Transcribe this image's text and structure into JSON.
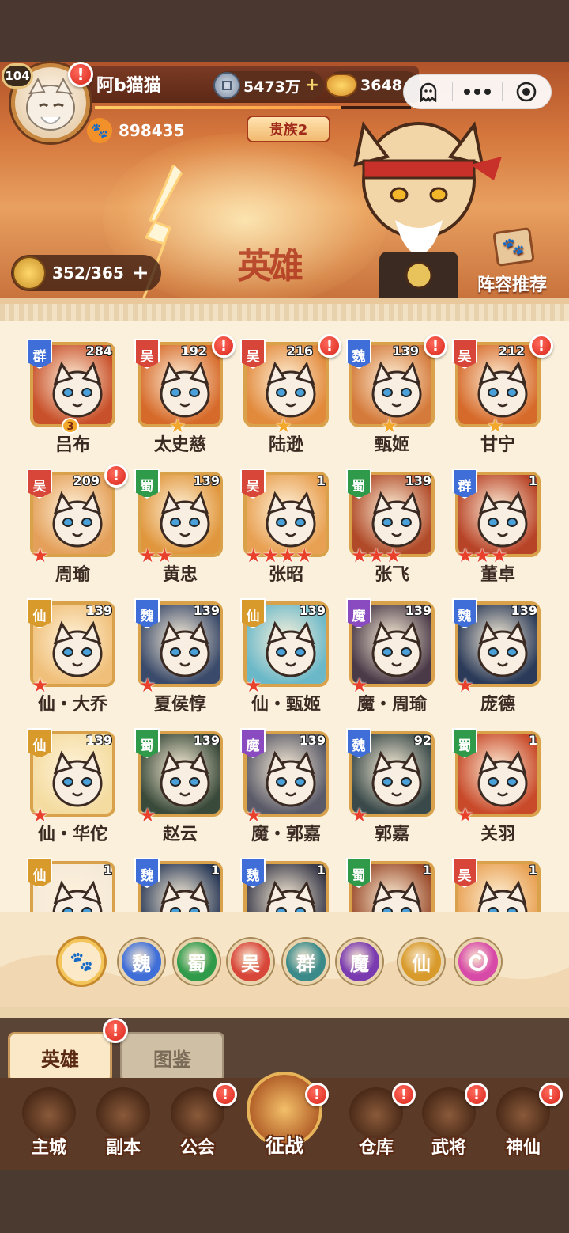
{
  "player": {
    "level": "104",
    "name": "阿b猫猫",
    "silver": "5473万",
    "gold": "3648",
    "power": "898435",
    "noble": "贵族2",
    "roster": "352/365",
    "lineup_label": "阵容推荐",
    "xp_fraction": 0.78
  },
  "banner": {
    "art_text": "英雄"
  },
  "colors": {
    "群": "#3f6ed8",
    "吴": "#d8463a",
    "魏": "#3f6ed8",
    "蜀": "#2f9a4a",
    "仙": "#d89a2a",
    "魔": "#8a4ac0"
  },
  "heroes": [
    {
      "faction": "群",
      "level": "284",
      "name": "吕布",
      "stars": 1,
      "star_color": "gold",
      "awaken": "3",
      "alert": false,
      "bg": "#c8502a"
    },
    {
      "faction": "吴",
      "level": "192",
      "name": "太史慈",
      "stars": 1,
      "star_color": "gold",
      "alert": true,
      "bg": "#d66a2a"
    },
    {
      "faction": "吴",
      "level": "216",
      "name": "陆逊",
      "stars": 1,
      "star_color": "gold",
      "alert": true,
      "bg": "#e28a3c"
    },
    {
      "faction": "魏",
      "level": "139",
      "name": "甄姬",
      "stars": 1,
      "star_color": "gold",
      "alert": true,
      "bg": "#d47a3a"
    },
    {
      "faction": "吴",
      "level": "212",
      "name": "甘宁",
      "stars": 1,
      "star_color": "gold",
      "alert": true,
      "bg": "#d66a2a"
    },
    {
      "faction": "吴",
      "level": "209",
      "name": "周瑜",
      "stars": 1,
      "star_color": "red",
      "alert": true,
      "bg": "#e4a05a"
    },
    {
      "faction": "蜀",
      "level": "139",
      "name": "黄忠",
      "stars": 2,
      "star_color": "red",
      "alert": false,
      "bg": "#e0963c"
    },
    {
      "faction": "吴",
      "level": "1",
      "name": "张昭",
      "stars": 4,
      "star_color": "red",
      "alert": false,
      "bg": "#e8a052"
    },
    {
      "faction": "蜀",
      "level": "139",
      "name": "张飞",
      "stars": 3,
      "star_color": "red",
      "alert": false,
      "bg": "#b04a28"
    },
    {
      "faction": "群",
      "level": "1",
      "name": "董卓",
      "stars": 3,
      "star_color": "red",
      "alert": false,
      "bg": "#b84428"
    },
    {
      "faction": "仙",
      "level": "139",
      "name": "仙・大乔",
      "stars": 1,
      "star_color": "red",
      "alert": false,
      "bg": "#f0c07a"
    },
    {
      "faction": "魏",
      "level": "139",
      "name": "夏侯惇",
      "stars": 1,
      "star_color": "red",
      "alert": false,
      "bg": "#3a4a6a"
    },
    {
      "faction": "仙",
      "level": "139",
      "name": "仙・甄姬",
      "stars": 1,
      "star_color": "red",
      "alert": false,
      "bg": "#6ab8c8"
    },
    {
      "faction": "魔",
      "level": "139",
      "name": "魔・周瑜",
      "stars": 1,
      "star_color": "red",
      "alert": false,
      "bg": "#4a3a48"
    },
    {
      "faction": "魏",
      "level": "139",
      "name": "庞德",
      "stars": 1,
      "star_color": "red",
      "alert": false,
      "bg": "#2a3a58"
    },
    {
      "faction": "仙",
      "level": "139",
      "name": "仙・华佗",
      "stars": 1,
      "star_color": "red",
      "alert": false,
      "bg": "#f4dca0"
    },
    {
      "faction": "蜀",
      "level": "139",
      "name": "赵云",
      "stars": 1,
      "star_color": "red",
      "alert": false,
      "bg": "#3a4a3a"
    },
    {
      "faction": "魔",
      "level": "139",
      "name": "魔・郭嘉",
      "stars": 1,
      "star_color": "red",
      "alert": false,
      "bg": "#5a5a68"
    },
    {
      "faction": "魏",
      "level": "92",
      "name": "郭嘉",
      "stars": 1,
      "star_color": "red",
      "alert": false,
      "bg": "#3a4a4a"
    },
    {
      "faction": "蜀",
      "level": "1",
      "name": "关羽",
      "stars": 1,
      "star_color": "red",
      "alert": false,
      "bg": "#c84a2a"
    },
    {
      "faction": "仙",
      "level": "1",
      "name": "",
      "stars": 0,
      "star_color": "red",
      "alert": false,
      "bg": "#f4e8d8"
    },
    {
      "faction": "魏",
      "level": "1",
      "name": "",
      "stars": 0,
      "star_color": "red",
      "alert": false,
      "bg": "#2a3a58"
    },
    {
      "faction": "魏",
      "level": "1",
      "name": "",
      "stars": 0,
      "star_color": "red",
      "alert": false,
      "bg": "#3a3a4a"
    },
    {
      "faction": "蜀",
      "level": "1",
      "name": "",
      "stars": 0,
      "star_color": "red",
      "alert": false,
      "bg": "#9a4a2a"
    },
    {
      "faction": "吴",
      "level": "1",
      "name": "",
      "stars": 0,
      "star_color": "red",
      "alert": false,
      "bg": "#e8a052"
    }
  ],
  "filters": [
    {
      "label": "🐾",
      "color": "#fbe9c7",
      "active": true,
      "icon": "paw-icon"
    },
    {
      "label": "魏",
      "color": "#3f6ed8",
      "active": false
    },
    {
      "label": "蜀",
      "color": "#2f9a4a",
      "active": false
    },
    {
      "label": "吴",
      "color": "#d8463a",
      "active": false
    },
    {
      "label": "群",
      "color": "#3a8a8a",
      "active": false
    },
    {
      "label": "魔",
      "color": "#7a3ab0",
      "active": false
    },
    {
      "label": "仙",
      "color": "#d89a2a",
      "active": false
    },
    {
      "label": "",
      "color": "#d84aa8",
      "active": false,
      "icon": "swirl-icon"
    }
  ],
  "tabs": {
    "heroes": "英雄",
    "codex": "图鉴"
  },
  "nav": [
    {
      "label": "主城",
      "icon": "castle-icon",
      "alert": false
    },
    {
      "label": "副本",
      "icon": "sword-icon",
      "alert": false
    },
    {
      "label": "公会",
      "icon": "flag-icon",
      "alert": true
    },
    {
      "label": "征战",
      "icon": "battle-icon",
      "alert": true,
      "center": true
    },
    {
      "label": "仓库",
      "icon": "treasure-bag-icon",
      "alert": true
    },
    {
      "label": "武将",
      "icon": "hero-cat-icon",
      "alert": true
    },
    {
      "label": "神仙",
      "icon": "immortal-cat-icon",
      "alert": true
    }
  ],
  "capsule": {
    "icons": [
      "ghost-icon",
      "more-icon",
      "record-icon"
    ]
  }
}
